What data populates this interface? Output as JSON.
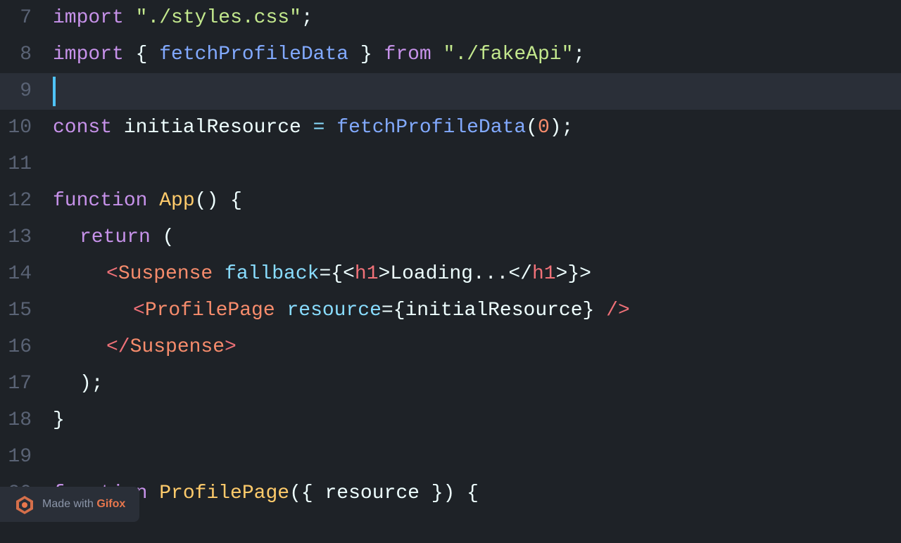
{
  "editor": {
    "background": "#1e2227",
    "lines": [
      {
        "number": "7",
        "active": false,
        "tokens": [
          {
            "text": "import",
            "class": "t-keyword"
          },
          {
            "text": " ",
            "class": "t-white"
          },
          {
            "text": "\"./styles.css\"",
            "class": "t-string"
          },
          {
            "text": ";",
            "class": "t-white"
          }
        ],
        "indent": 0
      },
      {
        "number": "8",
        "active": false,
        "tokens": [
          {
            "text": "import",
            "class": "t-keyword"
          },
          {
            "text": " { ",
            "class": "t-white"
          },
          {
            "text": "fetchProfileData",
            "class": "t-function"
          },
          {
            "text": " } ",
            "class": "t-white"
          },
          {
            "text": "from",
            "class": "t-from"
          },
          {
            "text": " ",
            "class": "t-white"
          },
          {
            "text": "\"./fakeApi\"",
            "class": "t-string"
          },
          {
            "text": ";",
            "class": "t-white"
          }
        ],
        "indent": 0
      },
      {
        "number": "9",
        "active": true,
        "tokens": [],
        "indent": 0,
        "cursor": true
      },
      {
        "number": "10",
        "active": false,
        "tokens": [
          {
            "text": "const",
            "class": "t-keyword"
          },
          {
            "text": " initialResource ",
            "class": "t-white"
          },
          {
            "text": "=",
            "class": "t-cyan"
          },
          {
            "text": " ",
            "class": "t-white"
          },
          {
            "text": "fetchProfileData",
            "class": "t-function"
          },
          {
            "text": "(",
            "class": "t-white"
          },
          {
            "text": "0",
            "class": "t-number"
          },
          {
            "text": ");",
            "class": "t-white"
          }
        ],
        "indent": 0
      },
      {
        "number": "11",
        "active": false,
        "tokens": [],
        "indent": 0
      },
      {
        "number": "12",
        "active": false,
        "tokens": [
          {
            "text": "function",
            "class": "t-keyword"
          },
          {
            "text": " ",
            "class": "t-white"
          },
          {
            "text": "App",
            "class": "t-yellow"
          },
          {
            "text": "() {",
            "class": "t-white"
          }
        ],
        "indent": 0
      },
      {
        "number": "13",
        "active": false,
        "tokens": [
          {
            "text": "return",
            "class": "t-keyword"
          },
          {
            "text": " (",
            "class": "t-white"
          }
        ],
        "indent": 1
      },
      {
        "number": "14",
        "active": false,
        "tokens": [
          {
            "text": "<",
            "class": "t-pink"
          },
          {
            "text": "Suspense",
            "class": "t-orange"
          },
          {
            "text": " ",
            "class": "t-white"
          },
          {
            "text": "fallback",
            "class": "t-cyan"
          },
          {
            "text": "={<",
            "class": "t-white"
          },
          {
            "text": "h1",
            "class": "t-pink"
          },
          {
            "text": ">Loading...</",
            "class": "t-white"
          },
          {
            "text": "h1",
            "class": "t-pink"
          },
          {
            "text": ">}>",
            "class": "t-white"
          }
        ],
        "indent": 2
      },
      {
        "number": "15",
        "active": false,
        "tokens": [
          {
            "text": "<",
            "class": "t-pink"
          },
          {
            "text": "ProfilePage",
            "class": "t-orange"
          },
          {
            "text": " ",
            "class": "t-white"
          },
          {
            "text": "resource",
            "class": "t-cyan"
          },
          {
            "text": "={initialResource}",
            "class": "t-white"
          },
          {
            "text": " />",
            "class": "t-pink"
          }
        ],
        "indent": 3
      },
      {
        "number": "16",
        "active": false,
        "tokens": [
          {
            "text": "</",
            "class": "t-pink"
          },
          {
            "text": "Suspense",
            "class": "t-orange"
          },
          {
            "text": ">",
            "class": "t-pink"
          }
        ],
        "indent": 2
      },
      {
        "number": "17",
        "active": false,
        "tokens": [
          {
            "text": ");",
            "class": "t-white"
          }
        ],
        "indent": 1
      },
      {
        "number": "18",
        "active": false,
        "tokens": [
          {
            "text": "}",
            "class": "t-white"
          }
        ],
        "indent": 0
      },
      {
        "number": "19",
        "active": false,
        "tokens": [],
        "indent": 0
      },
      {
        "number": "20",
        "active": false,
        "tokens": [
          {
            "text": "function",
            "class": "t-keyword"
          },
          {
            "text": " ",
            "class": "t-white"
          },
          {
            "text": "ProfilePage",
            "class": "t-yellow"
          },
          {
            "text": "({ ",
            "class": "t-white"
          },
          {
            "text": "resource",
            "class": "t-white"
          },
          {
            "text": " }) {",
            "class": "t-white"
          }
        ],
        "indent": 0
      }
    ]
  },
  "watermark": {
    "text": "Made with ",
    "brand": "Gifox"
  }
}
